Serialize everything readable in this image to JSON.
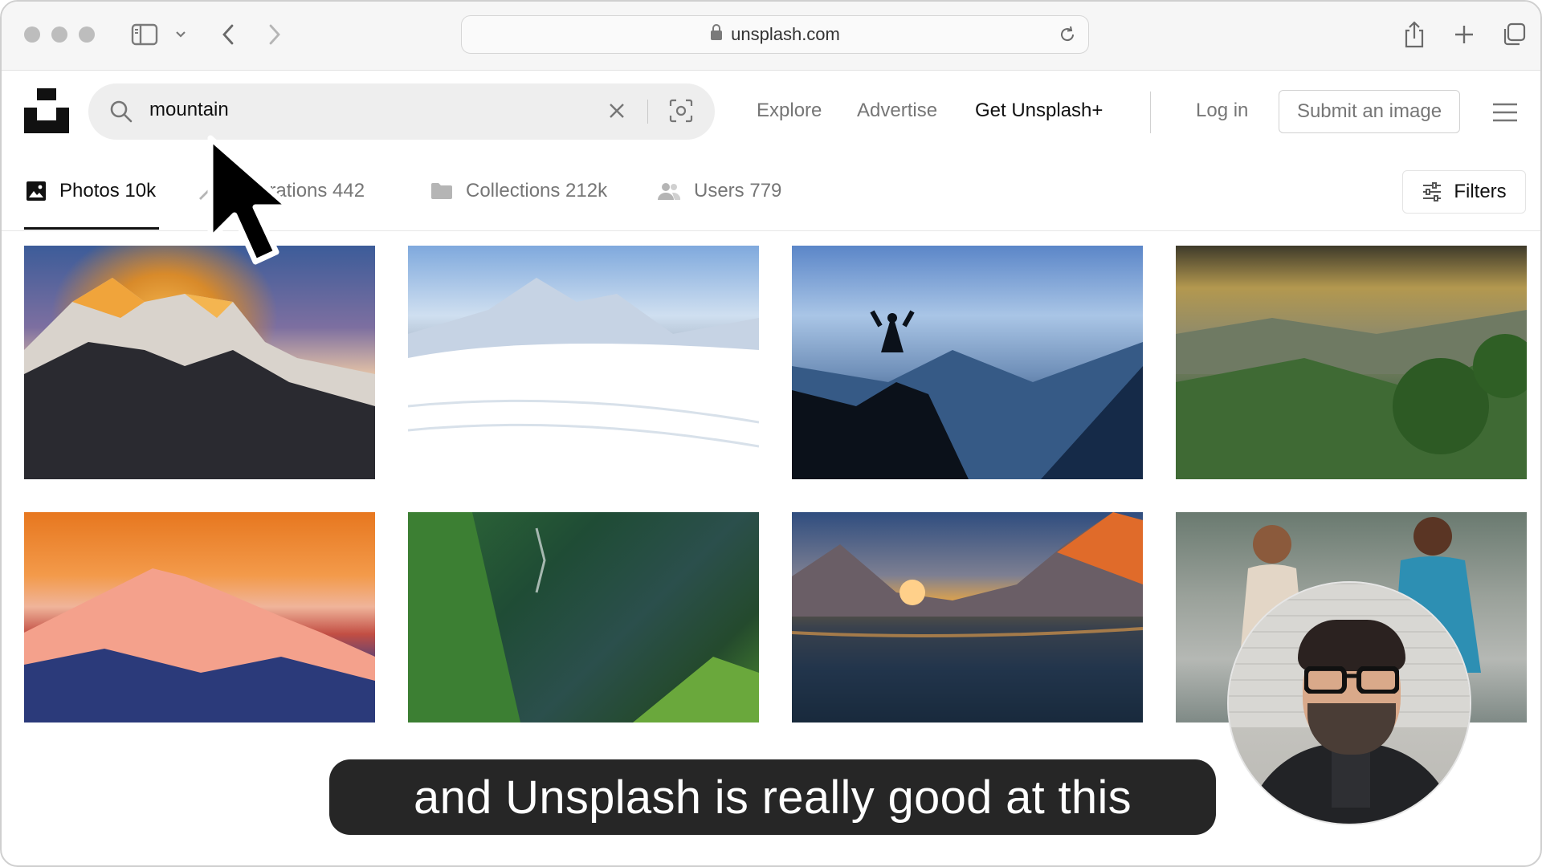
{
  "browser": {
    "url": "unsplash.com"
  },
  "header": {
    "search": {
      "query": "mountain"
    },
    "nav": {
      "explore": "Explore",
      "advertise": "Advertise",
      "get_plus": "Get Unsplash+",
      "login": "Log in",
      "submit": "Submit an image"
    }
  },
  "tabs": [
    {
      "label": "Photos 10k",
      "active": true
    },
    {
      "label": "Illustrations 442"
    },
    {
      "label": "Collections 212k"
    },
    {
      "label": "Users 779"
    }
  ],
  "filters_label": "Filters",
  "photos": [
    {
      "alt": "mountain-peaks-sunset"
    },
    {
      "alt": "snowy-mountains"
    },
    {
      "alt": "hiker-silhouette-summit"
    },
    {
      "alt": "misty-green-hills"
    },
    {
      "alt": "orange-mountain-range"
    },
    {
      "alt": "green-forest-valley"
    },
    {
      "alt": "mountain-lake-sunrise"
    },
    {
      "alt": "runners"
    }
  ],
  "caption": "and Unsplash is really good at this",
  "colors": {
    "caption_bg": "#262626",
    "accent_text": "#111111",
    "muted_text": "#767676"
  }
}
